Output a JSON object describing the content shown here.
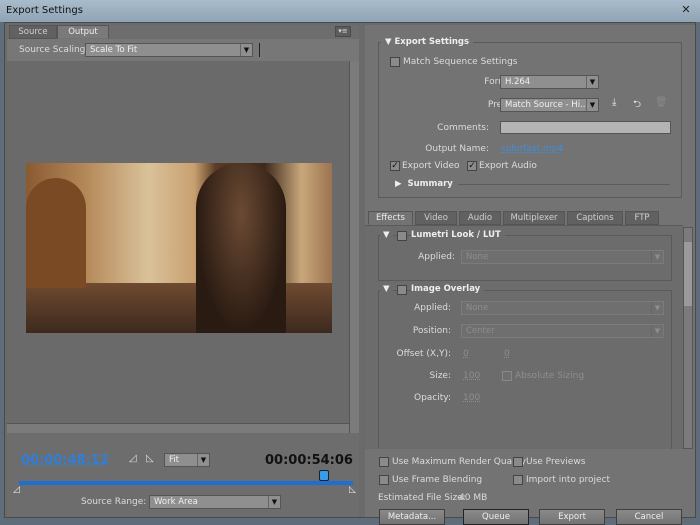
{
  "window": {
    "title": "Export Settings",
    "close_icon": "close-icon"
  },
  "left": {
    "tabs": [
      {
        "label": "Source"
      },
      {
        "label": "Output"
      }
    ],
    "active_tab": "Output",
    "source_scaling_label": "Source Scaling:",
    "source_scaling_value": "Scale To Fit",
    "current_time": "00:00:48:12",
    "duration": "00:00:54:06",
    "zoom_value": "Fit",
    "source_range_label": "Source Range:",
    "source_range_value": "Work Area",
    "playhead_fraction": 0.913
  },
  "export_settings": {
    "header": "Export Settings",
    "match_sequence": "Match Sequence Settings",
    "format_label": "Format:",
    "format_value": "H.264",
    "preset_label": "Preset:",
    "preset_value": "Match Source - Hi...",
    "comments_label": "Comments:",
    "comments_value": "",
    "output_name_label": "Output Name:",
    "output_name_value": "colorfast.mp4",
    "export_video": "Export Video",
    "export_audio": "Export Audio",
    "summary": "Summary"
  },
  "effects": {
    "tabs": [
      {
        "label": "Effects"
      },
      {
        "label": "Video"
      },
      {
        "label": "Audio"
      },
      {
        "label": "Multiplexer"
      },
      {
        "label": "Captions"
      },
      {
        "label": "FTP"
      }
    ],
    "lumetri": {
      "header": "Lumetri Look / LUT",
      "applied_label": "Applied:",
      "applied_value": "None"
    },
    "overlay": {
      "header": "Image Overlay",
      "applied_label": "Applied:",
      "applied_value": "None",
      "position_label": "Position:",
      "position_value": "Center",
      "offset_label": "Offset (X,Y):",
      "offset_x": "0",
      "offset_y": "0",
      "size_label": "Size:",
      "size_value": "100",
      "absolute_sizing": "Absolute Sizing",
      "opacity_label": "Opacity:",
      "opacity_value": "100"
    }
  },
  "bottom": {
    "max_render": "Use Maximum Render Quality",
    "use_previews": "Use Previews",
    "frame_blending": "Use Frame Blending",
    "import_project": "Import into project",
    "file_size_label": "Estimated File Size:",
    "file_size_value": "40 MB",
    "metadata": "Metadata...",
    "queue": "Queue",
    "export": "Export",
    "cancel": "Cancel"
  },
  "colors": {
    "timecode": "#2f7fd8",
    "link": "#3d8fe0",
    "timeline": "#1f6fd0"
  }
}
